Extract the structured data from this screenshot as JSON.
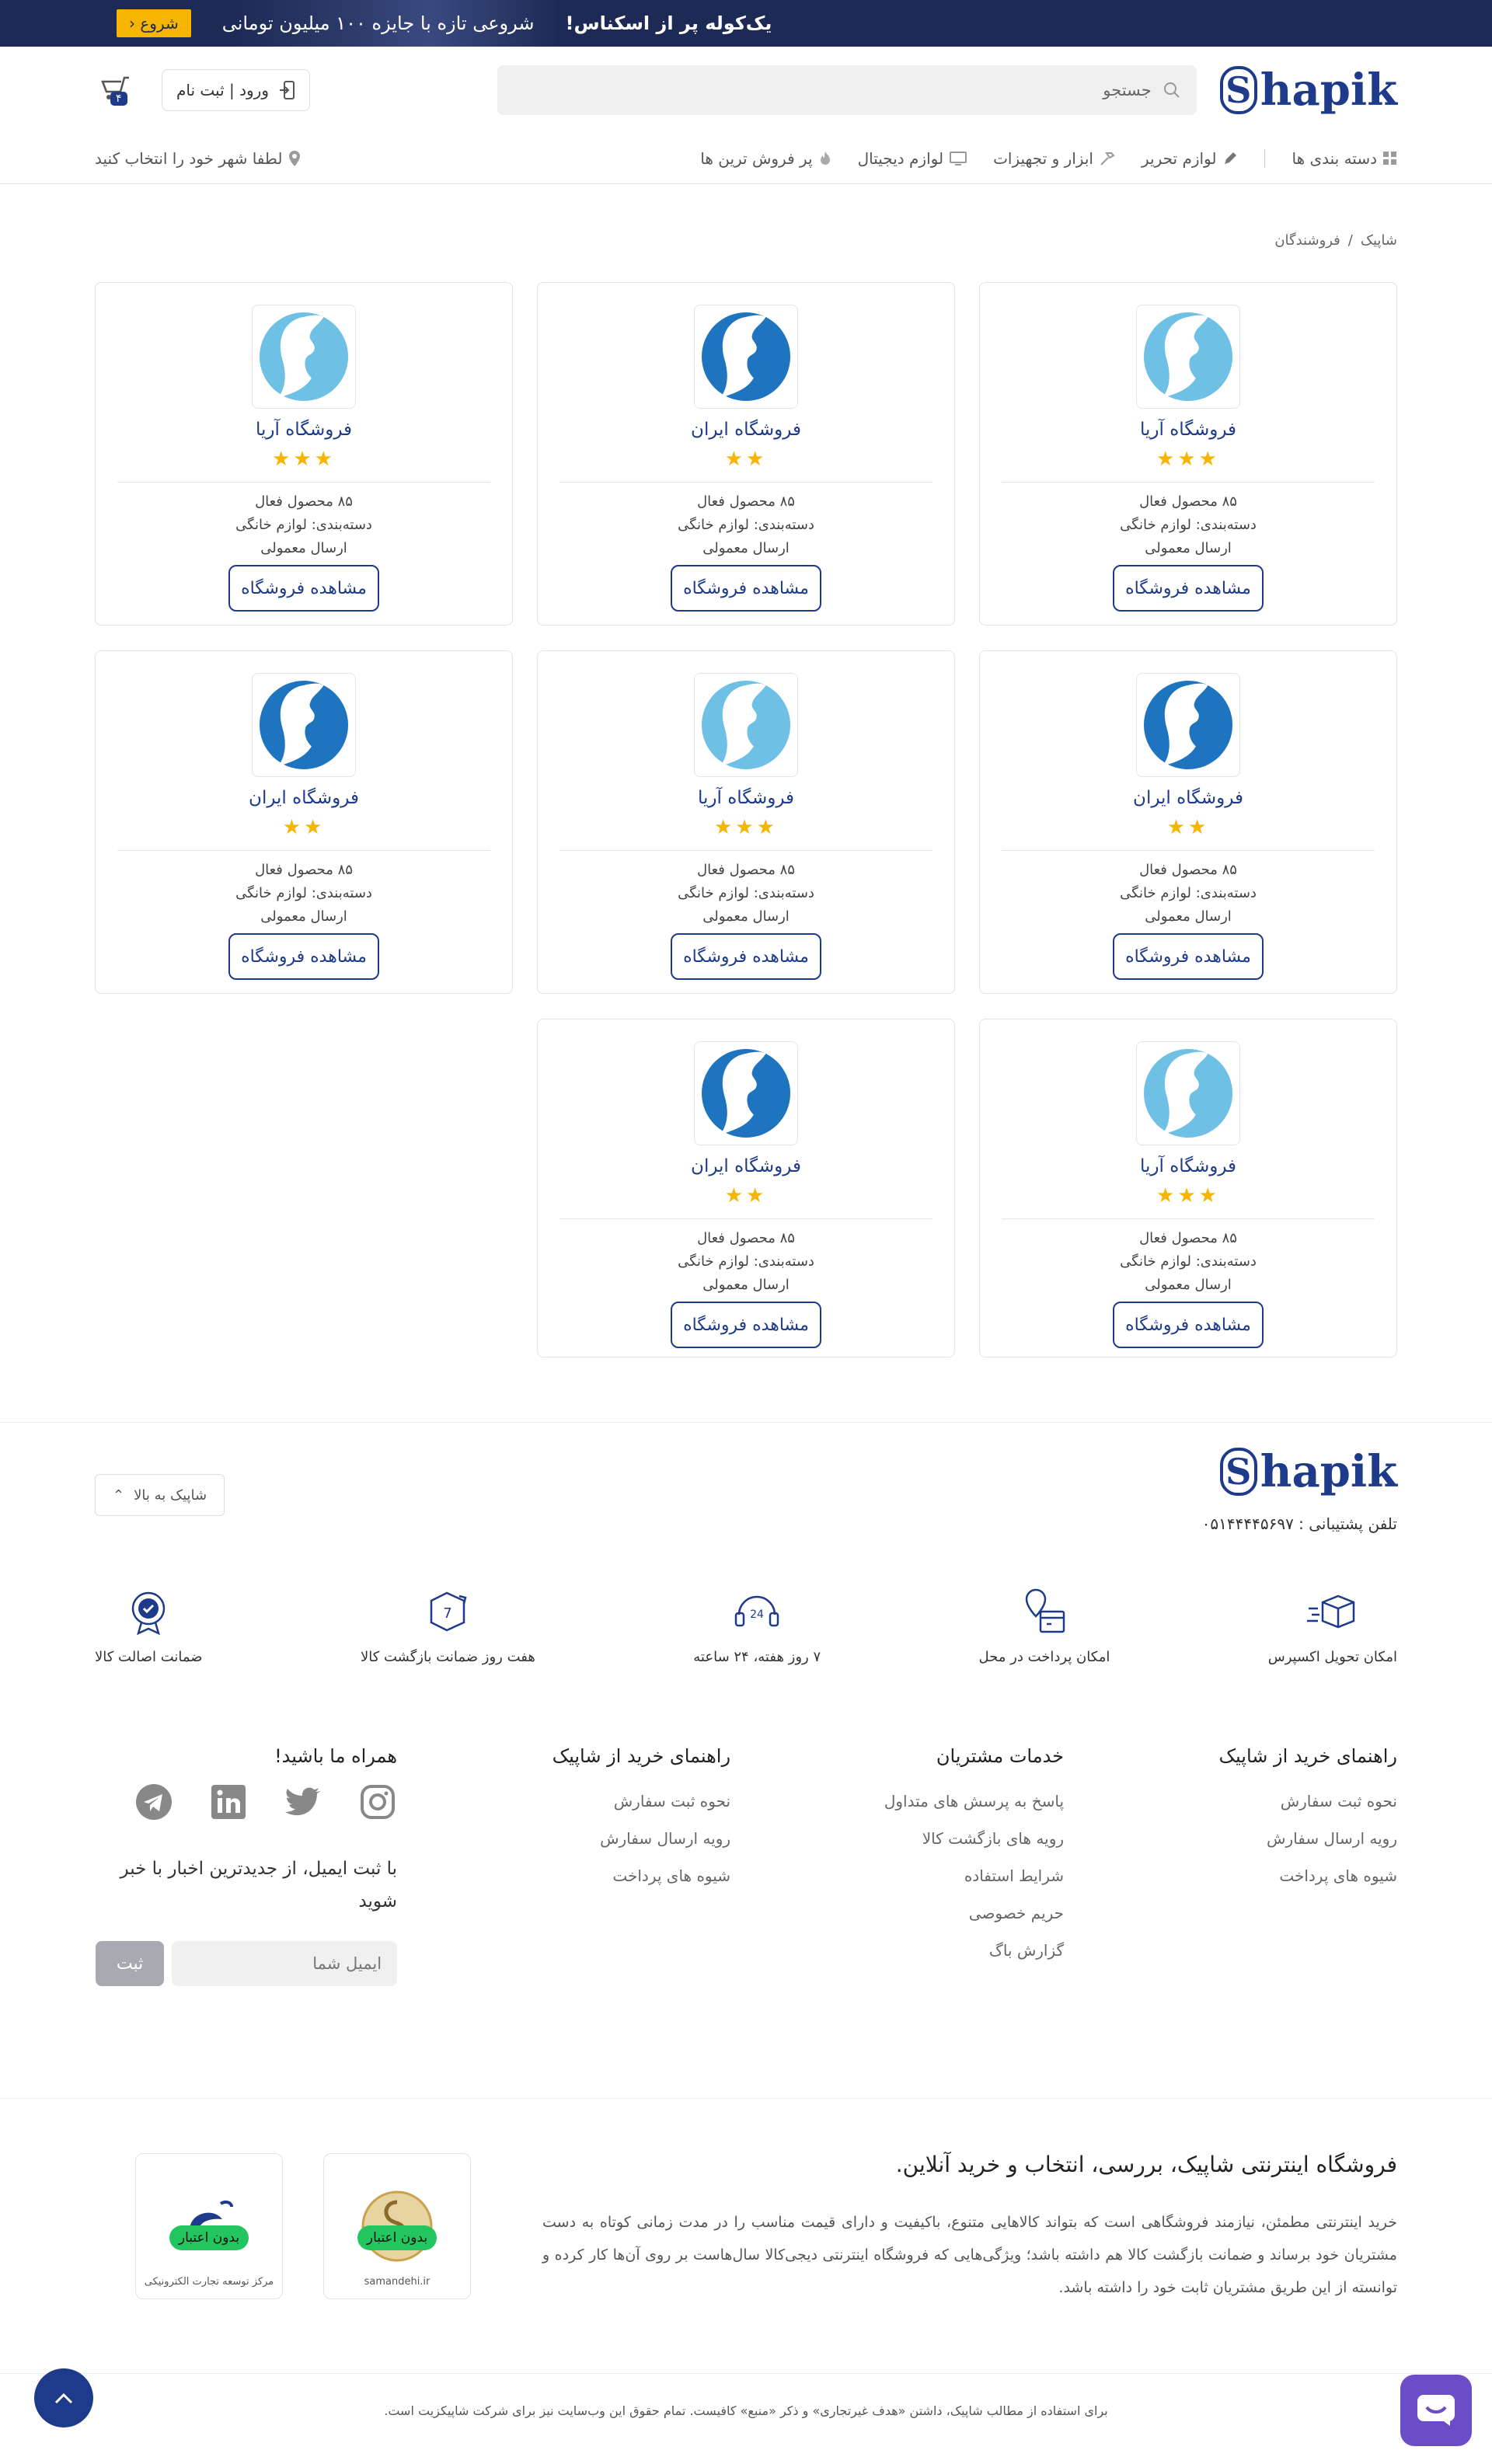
{
  "banner": {
    "title": "یک‌کوله پر از اسکناس!",
    "subtitle": "شروعی تازه با جایزه ۱۰۰ میلیون تومانی",
    "button": "شروع"
  },
  "header": {
    "logo_text": "hapik",
    "logo_mark": "S",
    "search_placeholder": "جستجو",
    "login_label": "ورود | ثبت نام",
    "cart_count": "۴"
  },
  "nav": {
    "items": [
      {
        "label": "دسته بندی ها",
        "icon": "grid-icon"
      },
      {
        "label": "لوازم تحریر",
        "icon": "pencil-icon"
      },
      {
        "label": "ابزار و تجهیزات",
        "icon": "hammer-icon"
      },
      {
        "label": "لوازم دیجیتال",
        "icon": "monitor-icon"
      },
      {
        "label": "پر فروش ترین ها",
        "icon": "fire-icon"
      }
    ],
    "city_label": "لطفا شهر خود را انتخاب کنید"
  },
  "breadcrumb": {
    "home": "شاپیک",
    "separator": "/",
    "current": "فروشندگان"
  },
  "stores": [
    {
      "name": "فروشگاه آریا",
      "stars": "★★★",
      "logo_color": "#6ec1e4",
      "products": "۸۵ محصول فعال",
      "category": "دسته‌بندی: لوازم خانگی",
      "shipping": "ارسال معمولی",
      "button": "مشاهده فروشگاه"
    },
    {
      "name": "فروشگاه ایران",
      "stars": "★★",
      "logo_color": "#1f74c0",
      "products": "۸۵ محصول فعال",
      "category": "دسته‌بندی: لوازم خانگی",
      "shipping": "ارسال معمولی",
      "button": "مشاهده فروشگاه"
    },
    {
      "name": "فروشگاه آریا",
      "stars": "★★★",
      "logo_color": "#6ec1e4",
      "products": "۸۵ محصول فعال",
      "category": "دسته‌بندی: لوازم خانگی",
      "shipping": "ارسال معمولی",
      "button": "مشاهده فروشگاه"
    },
    {
      "name": "فروشگاه ایران",
      "stars": "★★",
      "logo_color": "#1f74c0",
      "products": "۸۵ محصول فعال",
      "category": "دسته‌بندی: لوازم خانگی",
      "shipping": "ارسال معمولی",
      "button": "مشاهده فروشگاه"
    },
    {
      "name": "فروشگاه آریا",
      "stars": "★★★",
      "logo_color": "#6ec1e4",
      "products": "۸۵ محصول فعال",
      "category": "دسته‌بندی: لوازم خانگی",
      "shipping": "ارسال معمولی",
      "button": "مشاهده فروشگاه"
    },
    {
      "name": "فروشگاه ایران",
      "stars": "★★",
      "logo_color": "#1f74c0",
      "products": "۸۵ محصول فعال",
      "category": "دسته‌بندی: لوازم خانگی",
      "shipping": "ارسال معمولی",
      "button": "مشاهده فروشگاه"
    },
    {
      "name": "فروشگاه آریا",
      "stars": "★★★",
      "logo_color": "#6ec1e4",
      "products": "۸۵ محصول فعال",
      "category": "دسته‌بندی: لوازم خانگی",
      "shipping": "ارسال معمولی",
      "button": "مشاهده فروشگاه"
    },
    {
      "name": "فروشگاه ایران",
      "stars": "★★",
      "logo_color": "#1f74c0",
      "products": "۸۵ محصول فعال",
      "category": "دسته‌بندی: لوازم خانگی",
      "shipping": "ارسال معمولی",
      "button": "مشاهده فروشگاه"
    }
  ],
  "footer": {
    "logo_text": "hapik",
    "logo_mark": "S",
    "phone": "تلفن پشتیبانی : ۰۵۱۴۴۴۴۵۶۹۷",
    "back_to_top": "شاپیک به بالا",
    "features": [
      {
        "label": "امکان تحویل اکسپرس",
        "icon": "delivery-box-icon"
      },
      {
        "label": "امکان پرداخت در محل",
        "icon": "pay-location-icon"
      },
      {
        "label": "۷ روز هفته، ۲۴ ساعته",
        "icon": "support-24-icon"
      },
      {
        "label": "هفت روز ضمانت بازگشت کالا",
        "icon": "return-7-icon"
      },
      {
        "label": "ضمانت اصالت کالا",
        "icon": "original-badge-icon"
      }
    ],
    "columns": [
      {
        "title": "راهنمای خرید از شاپیک",
        "links": [
          "نحوه ثبت سفارش",
          "رویه ارسال سفارش",
          "شیوه های پرداخت"
        ]
      },
      {
        "title": "خدمات مشتریان",
        "links": [
          "پاسخ به پرسش های متداول",
          "رویه های بازگشت کالا",
          "شرایط استفاده",
          "حریم خصوصی",
          "گزارش باگ"
        ]
      },
      {
        "title": "راهنمای خرید از شاپیک",
        "links": [
          "نحوه ثبت سفارش",
          "رویه ارسال سفارش",
          "شیوه های پرداخت"
        ]
      }
    ],
    "social_title": "همراه ما باشید!",
    "newsletter_text": "با ثبت ایمیل، از جدیدترین اخبار با خبر شوید",
    "email_placeholder": "ایمیل شما",
    "submit_label": "ثبت",
    "about_title": "فروشگاه اینترنتی شاپیک، بررسی، انتخاب و خرید آنلاین.",
    "about_text": "خرید اینترنتی مطمئن، نیازمند فروشگاهی است که بتواند کالاهایی متنوع، باکیفیت و دارای قیمت مناسب را در مدت زمانی کوتاه به دست مشتریان خود برساند و ضمانت بازگشت کالا هم داشته باشد؛ ویژگی‌هایی که فروشگاه اینترنتی دیجی‌کالا سال‌هاست بر روی آن‌ها کار کرده و توانسته از این طریق مشتریان ثابت خود را داشته باشد.",
    "badge_tag": "بدون اعتبار",
    "badge1_caption": "samandehi.ir",
    "badge2_caption": "مرکز توسعه تجارت الکترونیکی",
    "copyright": "برای استفاده از مطالب شاپیک، داشتن «هدف غیرتجاری» و ذکر «منبع» کافیست. تمام حقوق این وب‌سایت نیز برای شرکت شاپیکزیت است."
  },
  "colors": {
    "primary": "#1e3a8a",
    "banner_bg": "#1d2a55",
    "accent_yellow": "#f7b500",
    "chat_purple": "#6d4cc7",
    "badge_green": "#22c55e"
  }
}
